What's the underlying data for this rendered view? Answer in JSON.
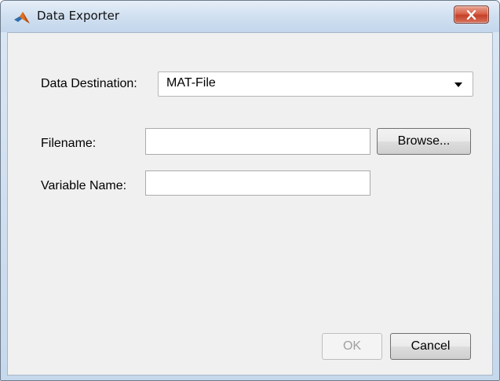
{
  "window": {
    "title": "Data Exporter",
    "close_label": "Close"
  },
  "form": {
    "destination_label": "Data Destination:",
    "destination_value": "MAT-File",
    "filename_label": "Filename:",
    "filename_value": "",
    "browse_label": "Browse...",
    "variable_label": "Variable Name:",
    "variable_value": ""
  },
  "buttons": {
    "ok_label": "OK",
    "cancel_label": "Cancel"
  },
  "icons": {
    "app": "matlab-logo-icon",
    "close": "close-x-icon",
    "dropdown": "dropdown-arrow-icon"
  },
  "colors": {
    "close_button": "#c4402a",
    "dialog_background": "#f0f0f0"
  }
}
